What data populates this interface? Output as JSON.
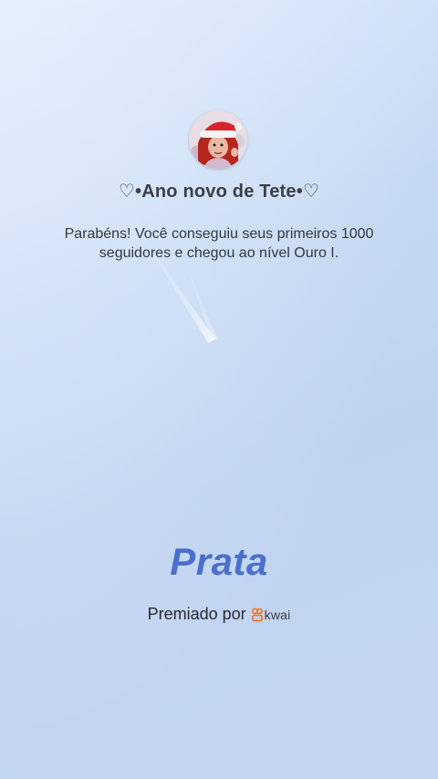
{
  "card": {
    "title": "♡•Ano novo de Tete•♡",
    "message": "Parabéns! Você conseguiu seus primeiros 1000 seguidores e chegou ao nível Ouro I.",
    "level": "Prata",
    "awarded_by_label": "Premiado por",
    "brand_name": "kwai"
  },
  "colors": {
    "level_text": "#4b6fcb",
    "brand_accent": "#ff6a1a",
    "background": "#c6d9f3"
  },
  "icons": {
    "avatar": "user-avatar-santa-hat",
    "brand": "kwai-logo-icon"
  }
}
